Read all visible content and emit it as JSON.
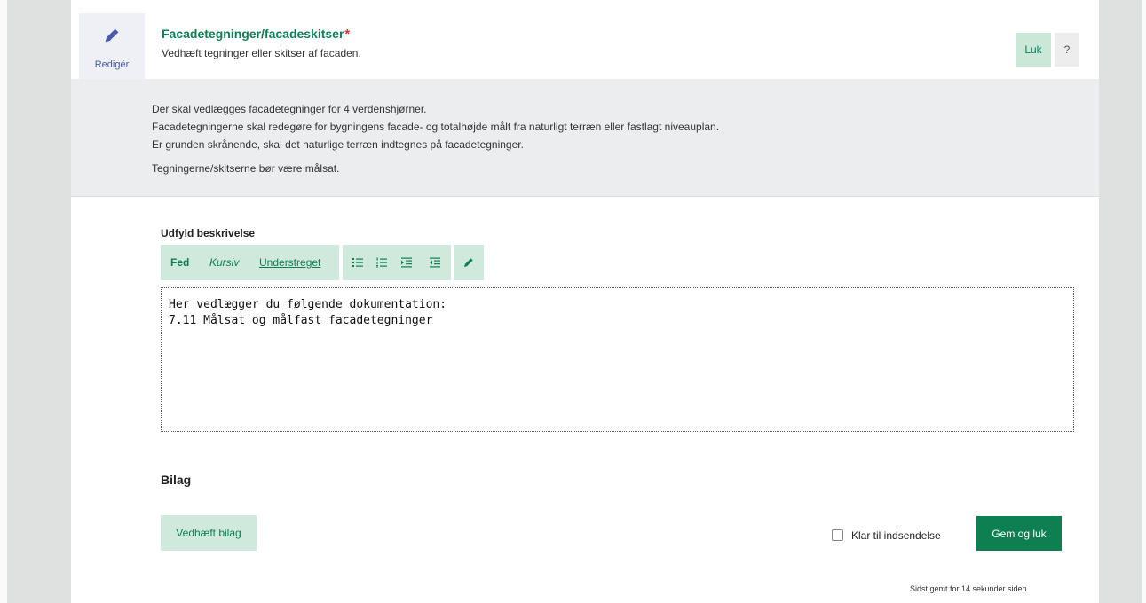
{
  "header": {
    "edit_label": "Redigér",
    "title": "Facadetegninger/facadeskitser",
    "required_marker": "*",
    "subtitle": "Vedhæft tegninger eller skitser af facaden.",
    "close_label": "Luk",
    "help_label": "?"
  },
  "info": {
    "lines": [
      "Der skal vedlægges facadetegninger for 4 verdenshjørner.",
      "Facadetegningerne skal redegøre for bygningens facade- og totalhøjde målt fra naturligt terræn eller fastlagt niveauplan.",
      "Er grunden skrånende, skal det naturlige terræn indtegnes på facadetegninger."
    ],
    "note": "Tegningerne/skitserne bør være målsat."
  },
  "editor": {
    "label": "Udfyld beskrivelse",
    "toolbar": {
      "bold": "Fed",
      "italic": "Kursiv",
      "underline": "Understreget"
    },
    "content": "Her vedlægger du følgende dokumentation:\n7.11 Målsat og målfast facadetegninger"
  },
  "attachments": {
    "title": "Bilag",
    "attach_button": "Vedhæft bilag",
    "ready_label": "Klar til indsendelse",
    "ready_checked": false,
    "save_button": "Gem og luk",
    "saved_status": "Sidst gemt for 14 sekunder siden"
  },
  "colors": {
    "accent_green": "#0e7f55",
    "light_green": "#cfe9dc",
    "required_red": "#d23b2a",
    "info_bg": "#ebedef"
  }
}
